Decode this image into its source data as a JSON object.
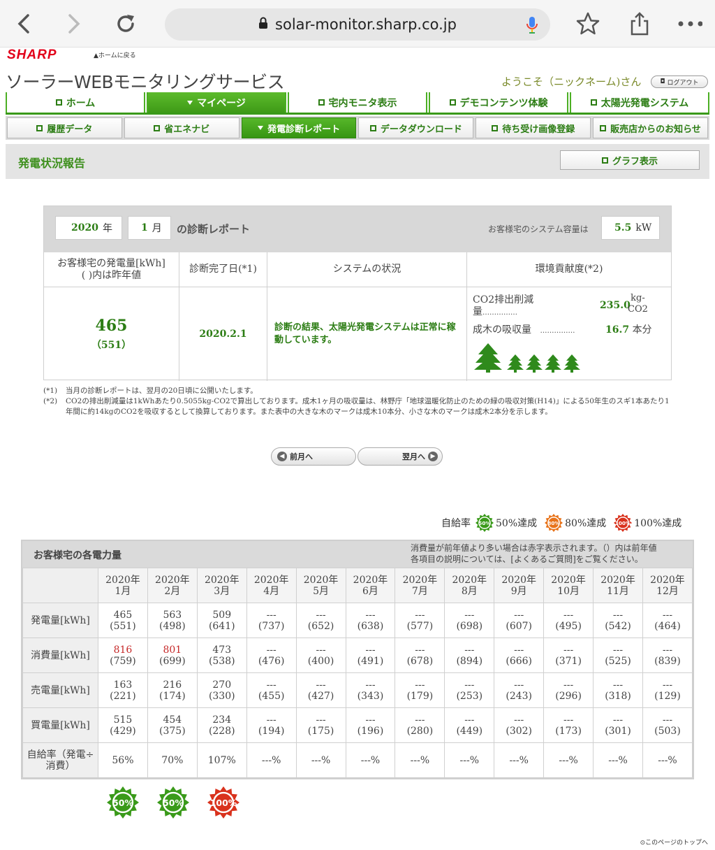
{
  "browser": {
    "url": "solar-monitor.sharp.co.jp"
  },
  "header": {
    "logo": "SHARP",
    "home_link": "ホームに戻る",
    "service_title": "ソーラーWEBモニタリングサービス",
    "welcome": "ようこそ（ニックネーム)さん",
    "logout": "ログアウト"
  },
  "nav_main": [
    "ホーム",
    "マイページ",
    "宅内モニタ表示",
    "デモコンテンツ体験",
    "太陽光発電システム"
  ],
  "nav_sub": [
    "履歴データ",
    "省エネナビ",
    "発電診断レポート",
    "データダウンロード",
    "待ち受け画像登録",
    "販売店からのお知らせ"
  ],
  "section": {
    "title": "発電状況報告",
    "graph_button": "グラフ表示"
  },
  "report": {
    "year": "2020",
    "year_unit": "年",
    "month": "1",
    "month_unit": "月",
    "title": "の診断レポート",
    "capacity_label": "お客様宅のシステム容量は",
    "capacity_value": "5.5",
    "capacity_unit": "kW",
    "headers": [
      "お客様宅の発電量[kWh]\n( )内は昨年値",
      "診断完了日(*1)",
      "システムの状況",
      "環境貢献度(*2)"
    ],
    "generation": "465",
    "generation_prev": "（551）",
    "completed_date": "2020.2.1",
    "status": "診断の結果、太陽光発電システムは正常に稼動しています。",
    "co2_label": "CO2排出削減量",
    "co2_dots": "……………",
    "co2_value": "235.0",
    "co2_unit_top": "kg-",
    "co2_unit_bottom": "CO2",
    "tree_label": "成木の吸収量",
    "tree_dots": "……………",
    "tree_value": "16.7",
    "tree_unit": "本分"
  },
  "notes": [
    {
      "mark": "(*1)",
      "text": "当月の診断レポートは、翌月の20日頃に公開いたします。"
    },
    {
      "mark": "(*2)",
      "text": "CO2の排出削減量は1kWhあたり0.5055kg-CO2で算出しております。成木1ヶ月の吸収量は、林野庁「地球温暖化防止のための緑の吸収対策(H14)」による50年生のスギ1本あたり1年間に約14kgのCO2を吸収するとして換算しております。また表中の大きな木のマークは成木10本分、小さな木のマークは成木2本分を示します。"
    }
  ],
  "pager": {
    "prev": "前月へ",
    "next": "翌月へ"
  },
  "legend": {
    "label": "自給率",
    "items": [
      {
        "badge": "50%",
        "text": "50%達成",
        "color": "#3a9a1a"
      },
      {
        "badge": "80%",
        "text": "80%達成",
        "color": "#e8731a"
      },
      {
        "badge": "100%",
        "text": "100%達成",
        "color": "#d9321d"
      }
    ]
  },
  "power": {
    "title": "お客様宅の各電力量",
    "note1": "消費量が前年値より多い場合は赤字表示されます。（）内は前年値",
    "note2": "各項目の説明については、[よくあるご質問]をご覧ください。",
    "months": [
      "2020年\n1月",
      "2020年\n2月",
      "2020年\n3月",
      "2020年\n4月",
      "2020年\n5月",
      "2020年\n6月",
      "2020年\n7月",
      "2020年\n8月",
      "2020年\n9月",
      "2020年\n10月",
      "2020年\n11月",
      "2020年\n12月"
    ],
    "rows": [
      {
        "label": "発電量[kWh]",
        "cur": [
          "465",
          "563",
          "509",
          "---",
          "---",
          "---",
          "---",
          "---",
          "---",
          "---",
          "---",
          "---"
        ],
        "prev": [
          "(551)",
          "(498)",
          "(641)",
          "(737)",
          "(652)",
          "(638)",
          "(577)",
          "(698)",
          "(607)",
          "(495)",
          "(542)",
          "(464)"
        ],
        "red": []
      },
      {
        "label": "消費量[kWh]",
        "cur": [
          "816",
          "801",
          "473",
          "---",
          "---",
          "---",
          "---",
          "---",
          "---",
          "---",
          "---",
          "---"
        ],
        "prev": [
          "(759)",
          "(699)",
          "(538)",
          "(476)",
          "(400)",
          "(491)",
          "(678)",
          "(894)",
          "(666)",
          "(371)",
          "(525)",
          "(839)"
        ],
        "red": [
          0,
          1
        ]
      },
      {
        "label": "売電量[kWh]",
        "cur": [
          "163",
          "216",
          "270",
          "---",
          "---",
          "---",
          "---",
          "---",
          "---",
          "---",
          "---",
          "---"
        ],
        "prev": [
          "(221)",
          "(174)",
          "(330)",
          "(455)",
          "(427)",
          "(343)",
          "(179)",
          "(253)",
          "(243)",
          "(296)",
          "(318)",
          "(129)"
        ],
        "red": []
      },
      {
        "label": "買電量[kWh]",
        "cur": [
          "515",
          "454",
          "234",
          "---",
          "---",
          "---",
          "---",
          "---",
          "---",
          "---",
          "---",
          "---"
        ],
        "prev": [
          "(429)",
          "(375)",
          "(228)",
          "(194)",
          "(175)",
          "(196)",
          "(280)",
          "(449)",
          "(302)",
          "(173)",
          "(301)",
          "(503)"
        ],
        "red": []
      }
    ],
    "ratio_label": "自給率（発電÷消費）",
    "ratio": [
      "56%",
      "70%",
      "107%",
      "---%",
      "---%",
      "---%",
      "---%",
      "---%",
      "---%",
      "---%",
      "---%",
      "---%"
    ],
    "badges": [
      {
        "text": "50%",
        "color": "#3a9a1a"
      },
      {
        "text": "50%",
        "color": "#3a9a1a"
      },
      {
        "text": "100%",
        "color": "#d9321d"
      }
    ]
  },
  "footer": {
    "top_link": "このページのトップへ"
  }
}
